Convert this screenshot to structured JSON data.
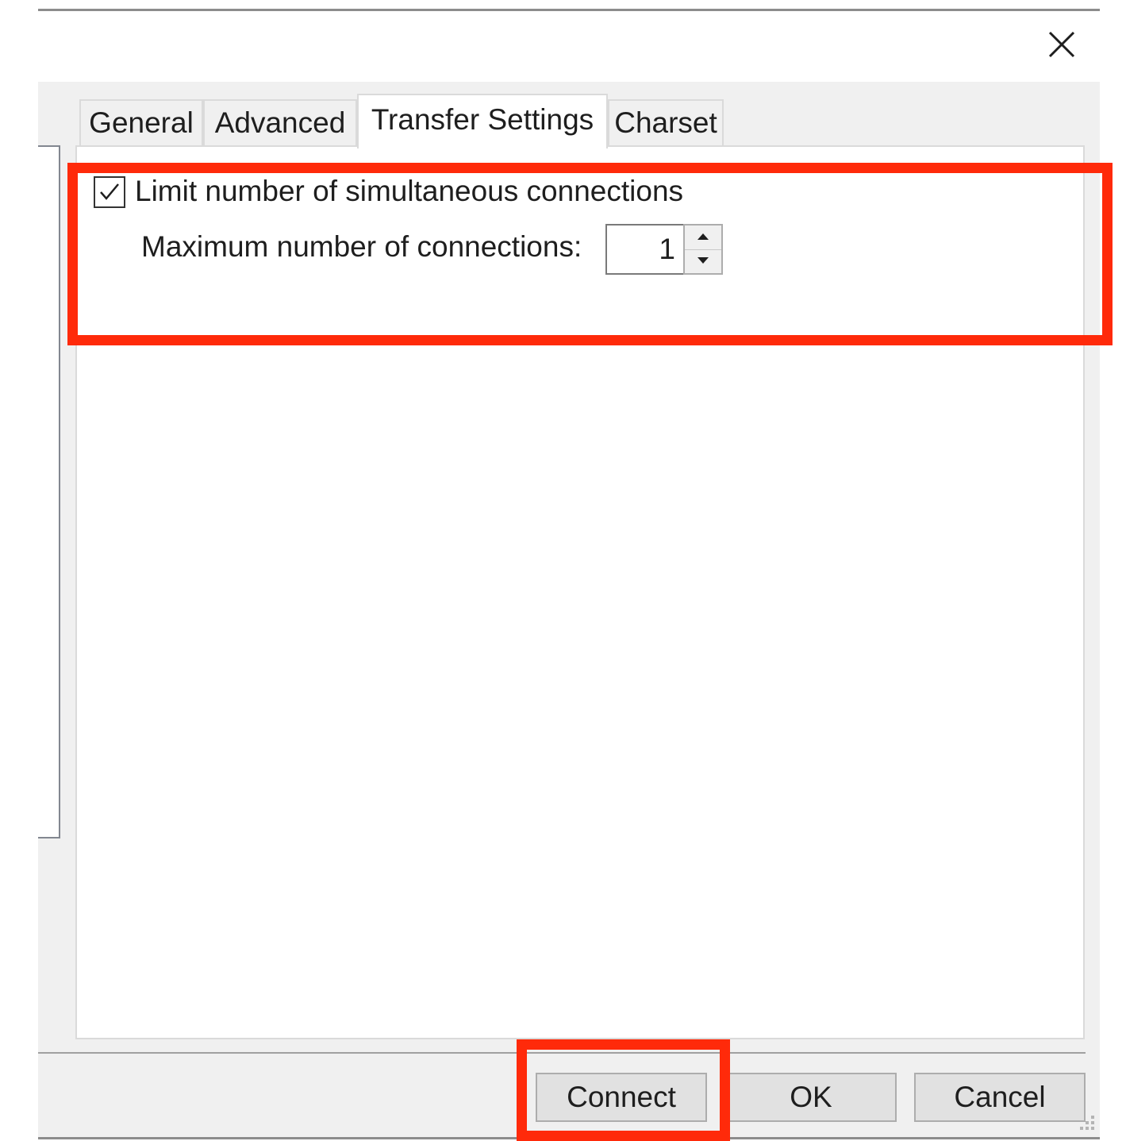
{
  "window": {
    "close_icon": "close-icon"
  },
  "tabs": [
    {
      "label": "General",
      "active": false
    },
    {
      "label": "Advanced",
      "active": false
    },
    {
      "label": "Transfer Settings",
      "active": true
    },
    {
      "label": "Charset",
      "active": false
    }
  ],
  "transfer_settings": {
    "limit_checkbox": {
      "label": "Limit number of simultaneous connections",
      "checked": true
    },
    "max_connections": {
      "label": "Maximum number of connections:",
      "value": "1"
    }
  },
  "buttons": {
    "connect": "Connect",
    "ok": "OK",
    "cancel": "Cancel"
  },
  "colors": {
    "highlight": "#ff2a0a",
    "dialog_background": "#f0f0f0",
    "panel_background": "#ffffff"
  }
}
